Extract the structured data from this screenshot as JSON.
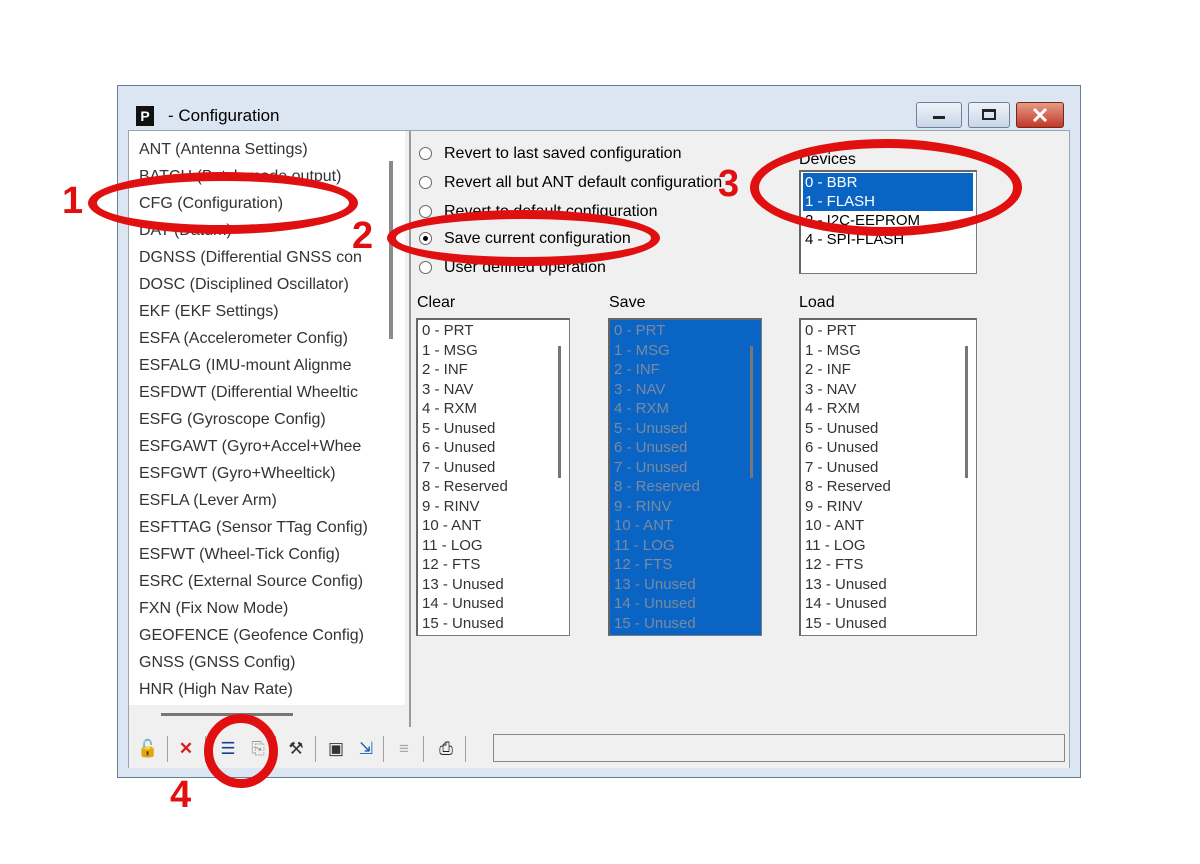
{
  "window": {
    "app_icon": "P",
    "title": " - Configuration",
    "controls": {
      "minimize": "minimize-icon",
      "maximize": "maximize-icon",
      "close": "close-icon"
    }
  },
  "message_list": [
    "ANT (Antenna Settings)",
    "BATCH (Batch mode output)",
    "CFG (Configuration)",
    "DAT (Datum)",
    "DGNSS (Differential GNSS con",
    "DOSC (Disciplined Oscillator)",
    "EKF (EKF Settings)",
    "ESFA (Accelerometer Config)",
    "ESFALG (IMU-mount Alignme",
    "ESFDWT (Differential Wheeltic",
    "ESFG (Gyroscope Config)",
    "ESFGAWT (Gyro+Accel+Whee",
    "ESFGWT (Gyro+Wheeltick)",
    "ESFLA (Lever Arm)",
    "ESFTTAG (Sensor TTag Config)",
    "ESFWT (Wheel-Tick Config)",
    "ESRC (External Source Config)",
    "FXN (Fix Now Mode)",
    "GEOFENCE (Geofence Config)",
    "GNSS (GNSS Config)",
    "HNR (High Nav Rate)"
  ],
  "options": [
    {
      "label": "Revert to last saved configuration",
      "checked": false
    },
    {
      "label": "Revert all but ANT default configuration",
      "checked": false
    },
    {
      "label": "Revert to default configuration",
      "checked": false
    },
    {
      "label": "Save current configuration",
      "checked": true
    },
    {
      "label": "User defined operation",
      "checked": false
    }
  ],
  "devices": {
    "label": "Devices",
    "items": [
      "0 - BBR",
      "1 - FLASH",
      "2 - I2C-EEPROM",
      "4 - SPI-FLASH"
    ],
    "selected": [
      "0 - BBR",
      "1 - FLASH"
    ]
  },
  "sections": [
    "0 - PRT",
    "1 - MSG",
    "2 - INF",
    "3 - NAV",
    "4 - RXM",
    "5 - Unused",
    "6 - Unused",
    "7 - Unused",
    "8 - Reserved",
    "9 - RINV",
    "10 - ANT",
    "11 - LOG",
    "12 - FTS",
    "13 - Unused",
    "14 - Unused",
    "15 - Unused"
  ],
  "clear": {
    "label": "Clear"
  },
  "save": {
    "label": "Save",
    "all_selected": true
  },
  "load": {
    "label": "Load"
  },
  "toolbar": {
    "icons": [
      "lock-icon",
      "delete-icon",
      "copy-icon",
      "paste-icon",
      "settings-icon",
      "send-icon",
      "poll-icon",
      "list-icon",
      "print-icon"
    ]
  },
  "annotations": [
    "1",
    "2",
    "3",
    "4"
  ],
  "annotation_color": "#e01010",
  "selection_color": "#0a64c4"
}
